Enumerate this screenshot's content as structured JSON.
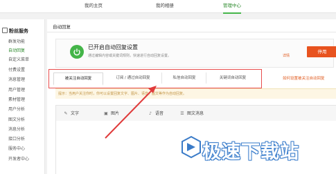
{
  "top_nav": {
    "home": "我的主页",
    "album": "我的相册",
    "admin": "管理中心"
  },
  "sidebar": {
    "header": "粉丝服务",
    "items": [
      "群发功能",
      "自动回复",
      "自定义菜单",
      "付费设置",
      "消息管理",
      "用户管理",
      "素材管理",
      "用户分析",
      "图文分析",
      "消息分析",
      "接口分析",
      "服务中心",
      "开发者中心"
    ]
  },
  "main": {
    "title": "自动回复",
    "banner": {
      "title": "已开启自动回复设置",
      "desc": "通过编辑内容或关键词规则，快速进行自动回复设置。",
      "link": "详情",
      "stop_label": "停用"
    },
    "tabs": [
      "被关注自动回复",
      "订阅 / 通过自动回复",
      "私信自动回复",
      "关键词自动回复"
    ],
    "tabs_help_link": "如何设置被关注自动回复",
    "tip": "提示：当用户关注你时，你可以设置回复文字、图片、语音、图文等作为自动回复。",
    "editor_tools": [
      "文字",
      "图片",
      "语音",
      "图文消息"
    ]
  },
  "watermark": "极速下载站",
  "colors": {
    "accent_green": "#44b549",
    "stop_orange": "#e8531f",
    "highlight_red": "#e84c4c"
  }
}
